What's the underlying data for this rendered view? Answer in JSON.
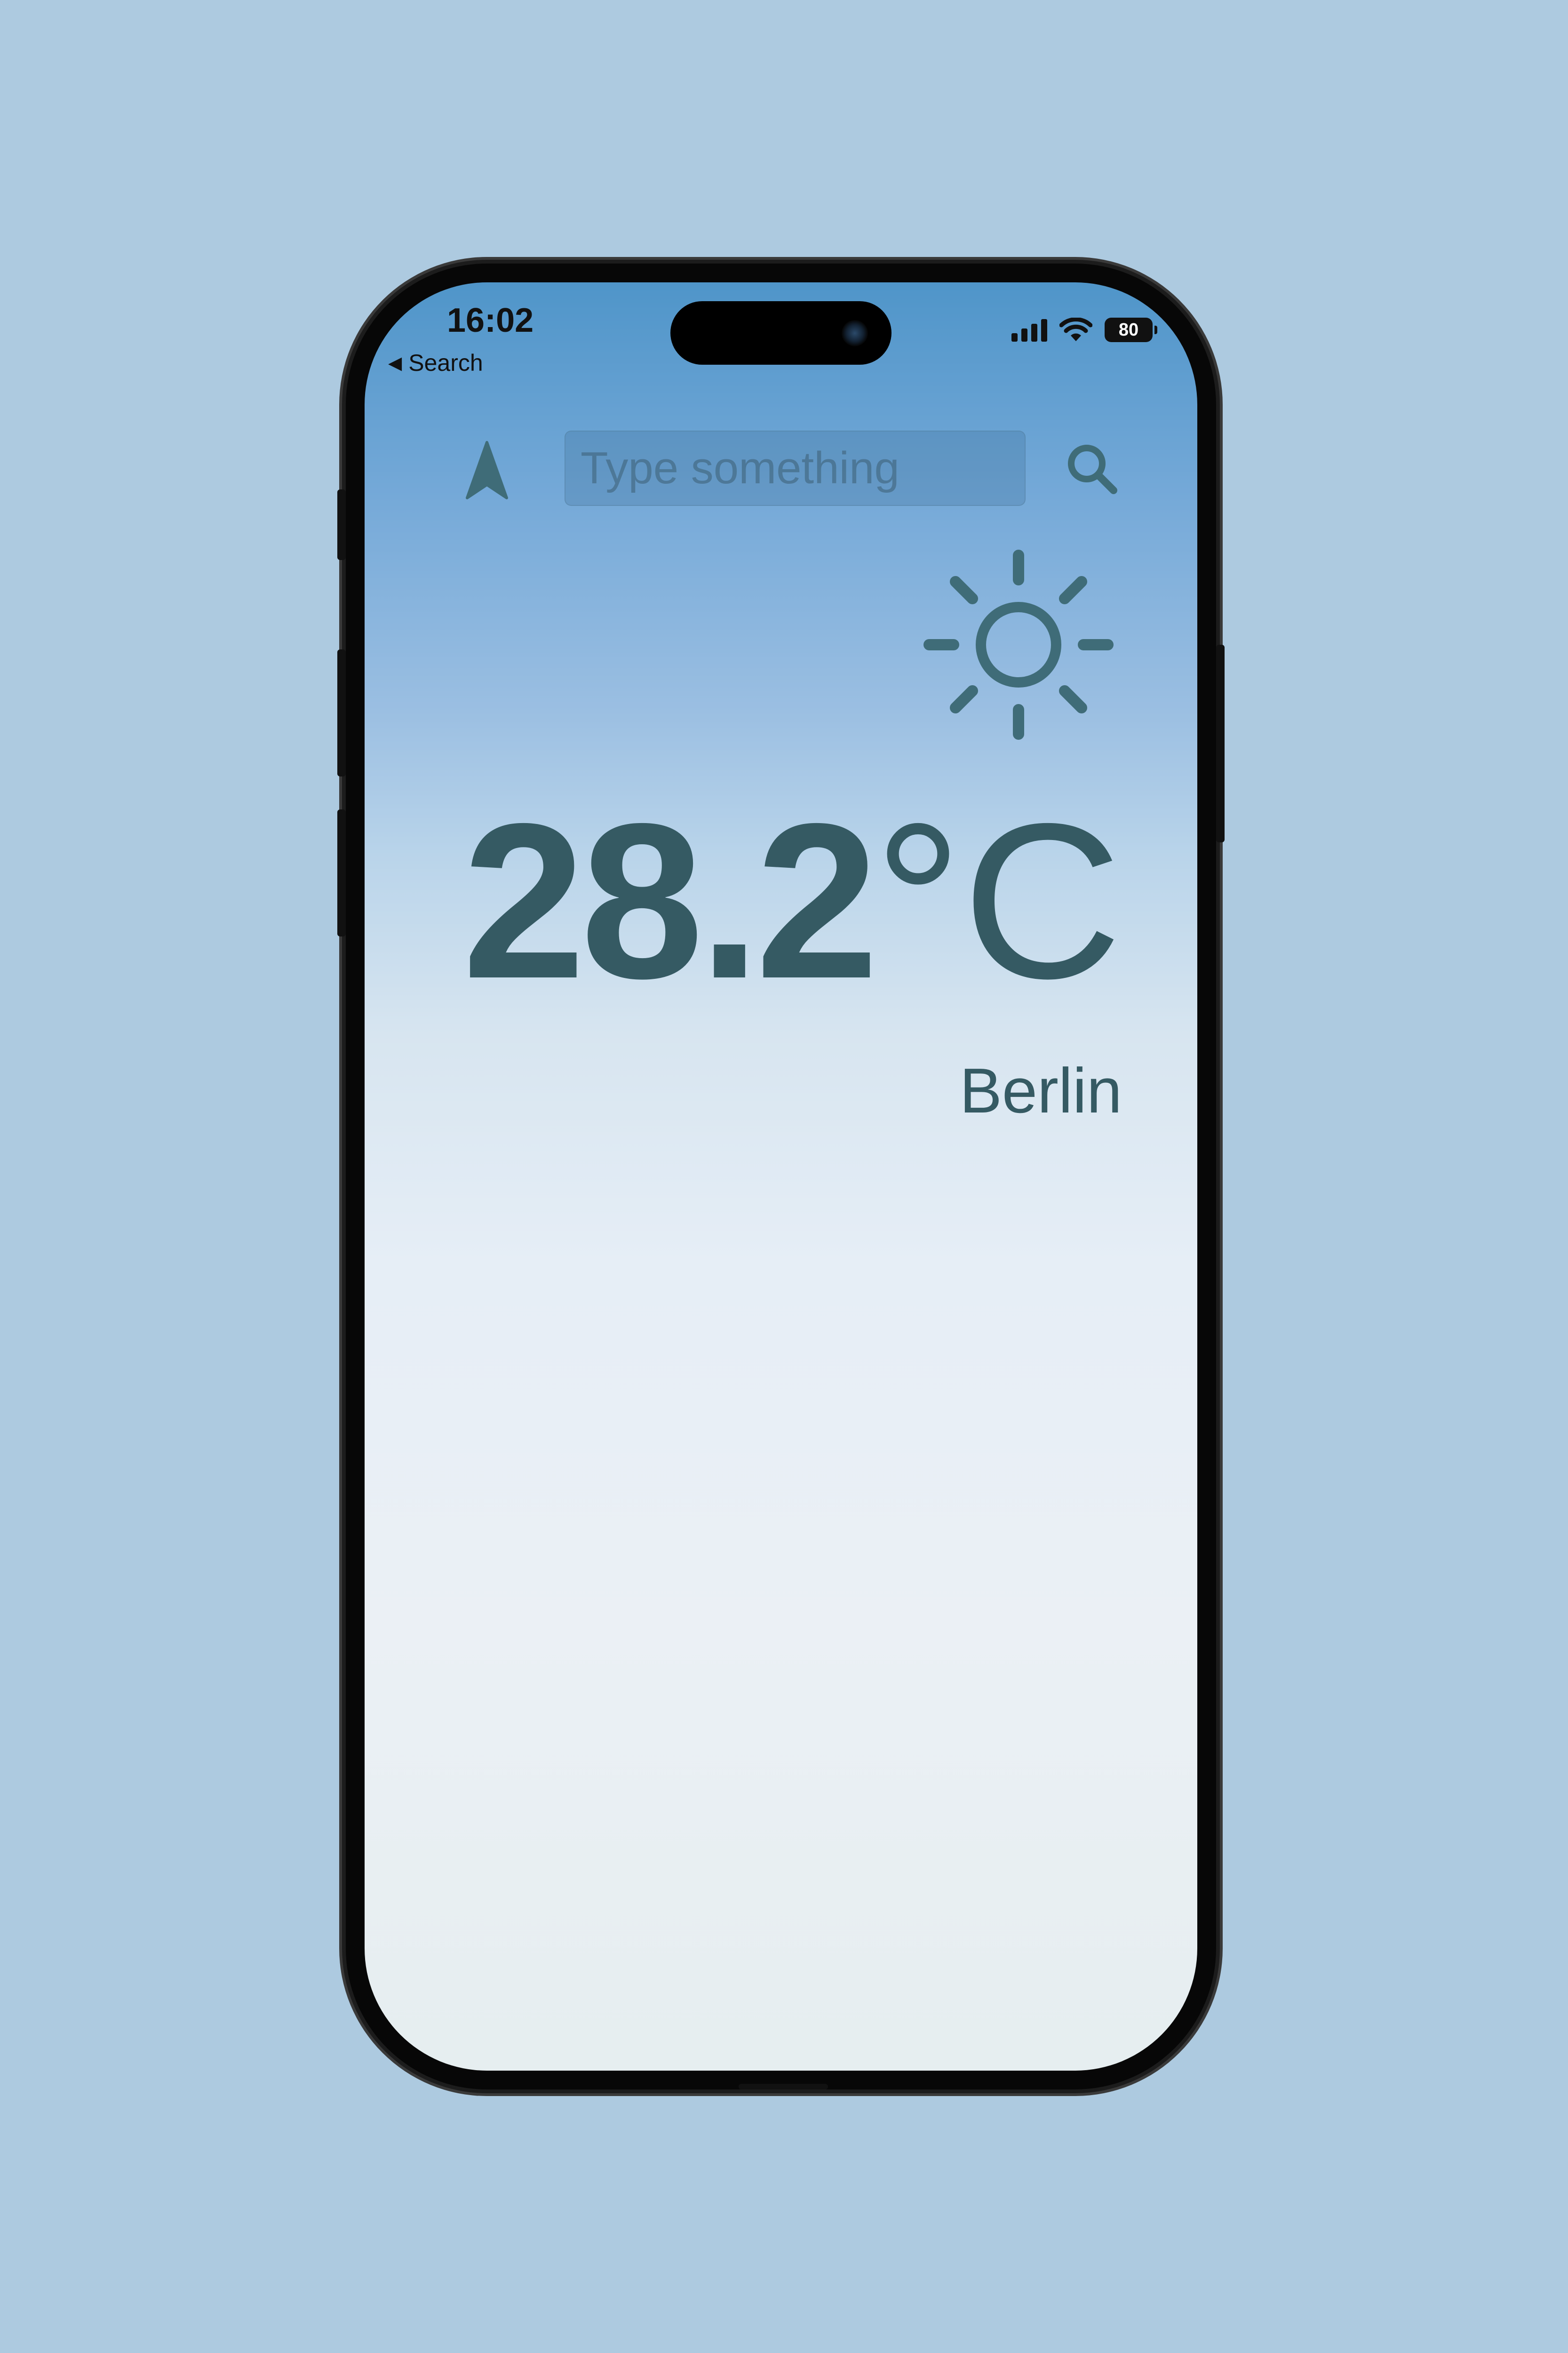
{
  "status_bar": {
    "time": "16:02",
    "back_label": "Search",
    "battery_level": "80"
  },
  "search": {
    "placeholder": "Type something"
  },
  "weather": {
    "temperature_value": "28.2",
    "temperature_unit": "°C",
    "city": "Berlin",
    "condition_icon": "sun-icon"
  },
  "colors": {
    "page_background": "#adcae0",
    "text_primary": "#355a63",
    "gradient_top": "#4f95c9",
    "gradient_bottom": "#e6eef0"
  }
}
